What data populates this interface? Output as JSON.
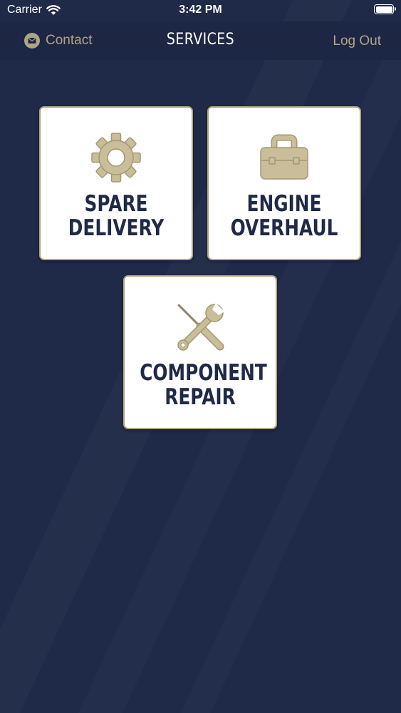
{
  "status_bar": {
    "carrier": "Carrier",
    "time": "3:42 PM"
  },
  "nav": {
    "contact_label": "Contact",
    "title": "SERVICES",
    "logout_label": "Log Out"
  },
  "colors": {
    "background": "#1f2a48",
    "accent_gold": "#b0a486",
    "tile_background": "#ffffff",
    "tile_text": "#1f2a48"
  },
  "services": [
    {
      "icon": "gear-icon",
      "line1": "SPARE",
      "line2": "DELIVERY"
    },
    {
      "icon": "toolbox-icon",
      "line1": "ENGINE",
      "line2": "OVERHAUL"
    },
    {
      "icon": "wrench-screwdriver-icon",
      "line1": "COMPONENT",
      "line2": "REPAIR"
    }
  ]
}
